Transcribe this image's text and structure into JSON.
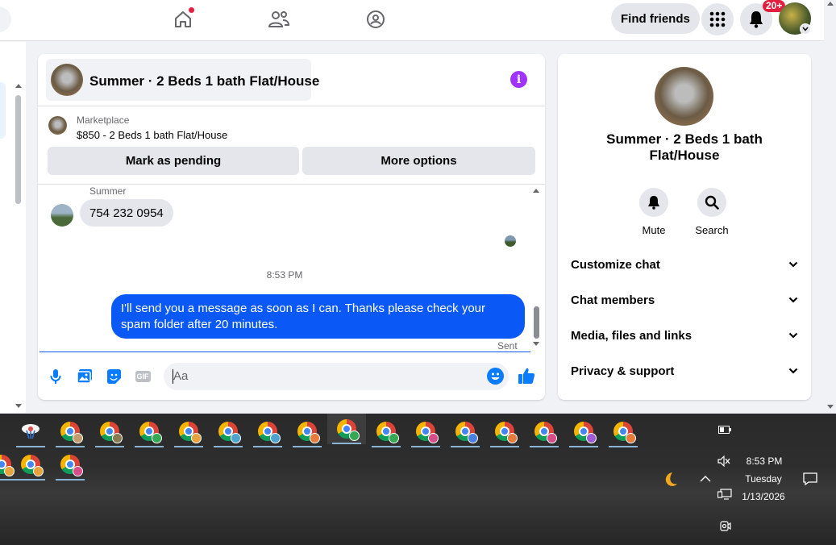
{
  "top_nav": {
    "find_friends_label": "Find friends",
    "notification_badge": "20+"
  },
  "chat": {
    "title": "Summer · 2 Beds 1 bath Flat/House",
    "listing": {
      "source": "Marketplace",
      "price_title": "$850 - 2 Beds 1 bath Flat/House"
    },
    "actions": {
      "mark_pending": "Mark as pending",
      "more_options": "More options"
    },
    "messages": {
      "incoming_sender": "Summer",
      "incoming_text": "754 232 0954",
      "timestamp": "8:53 PM",
      "outgoing_text": "I'll send you a message as soon as I can. Thanks please check your spam folder after 20 minutes.",
      "status": "Sent"
    },
    "composer": {
      "placeholder": "Aa",
      "gif_label": "GIF"
    }
  },
  "right_panel": {
    "title": "Summer · 2 Beds 1 bath Flat/House",
    "mute_label": "Mute",
    "search_label": "Search",
    "sections": [
      {
        "label": "Customize chat"
      },
      {
        "label": "Chat members"
      },
      {
        "label": "Media, files and links"
      },
      {
        "label": "Privacy & support"
      }
    ]
  },
  "taskbar": {
    "time": "8:53 PM",
    "day": "Tuesday",
    "date": "1/13/2026"
  },
  "colors": {
    "accent_blue": "#0a59f7",
    "info_purple": "#a033ff",
    "badge_red": "#e41e3f"
  }
}
